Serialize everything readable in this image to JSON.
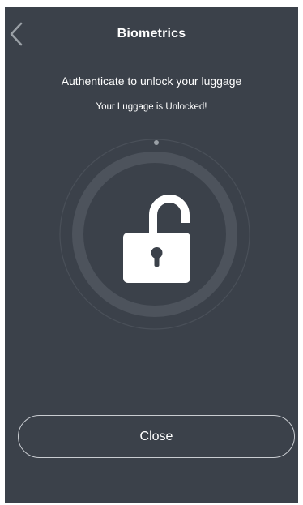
{
  "header": {
    "title": "Biometrics",
    "back_icon": "chevron-left-icon"
  },
  "prompt": {
    "instruction": "Authenticate to unlock your luggage",
    "status": "Your Luggage is Unlocked!"
  },
  "illustration": {
    "icon": "unlocked-padlock-icon",
    "ring_color": "#4d535c",
    "indicator_color": "#9aa0a6"
  },
  "actions": {
    "close_label": "Close"
  },
  "colors": {
    "background": "#3b414a",
    "text": "#ffffff",
    "button_border": "#c9ccd1"
  }
}
